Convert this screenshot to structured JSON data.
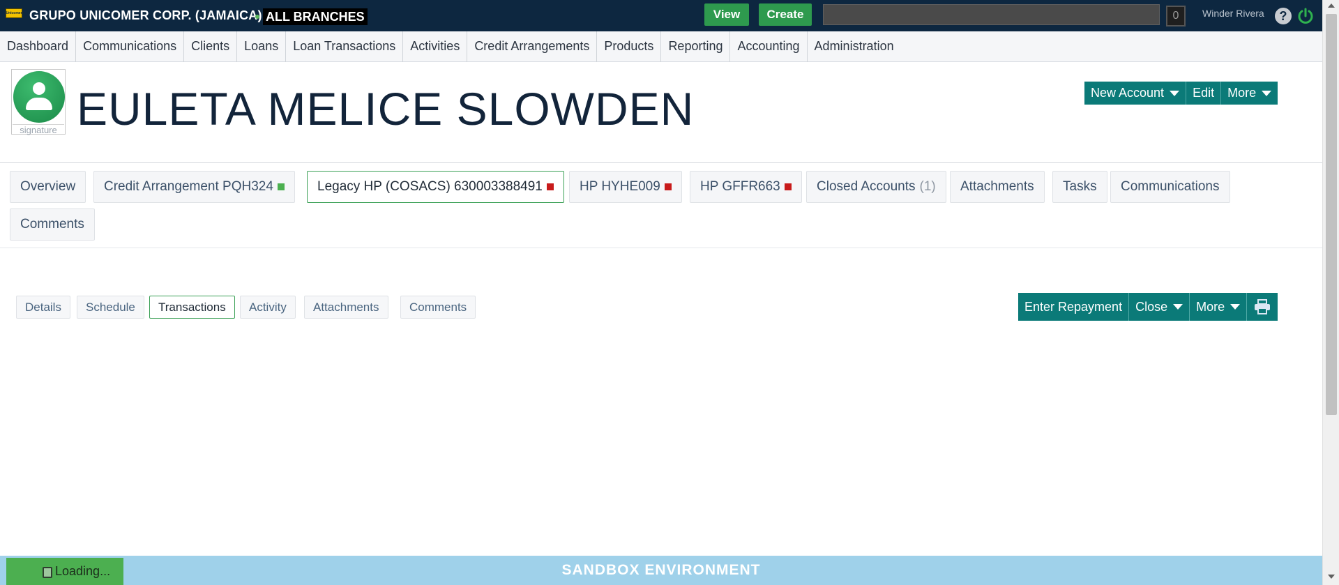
{
  "topbar": {
    "logo_text": "Unicomer",
    "org_name": "GRUPO UNICOMER CORP. (JAMAICA)",
    "branch": "ALL BRANCHES",
    "view_label": "View",
    "create_label": "Create",
    "search_value": "",
    "counter": "0",
    "user_name": "Winder Rivera",
    "help_glyph": "?"
  },
  "nav": {
    "items": [
      "Dashboard",
      "Communications",
      "Clients",
      "Loans",
      "Loan Transactions",
      "Activities",
      "Credit Arrangements",
      "Products",
      "Reporting",
      "Accounting",
      "Administration"
    ]
  },
  "client": {
    "name": "EULETA MELICE SLOWDEN",
    "avatar_caption": "signature",
    "actions": {
      "new_account": "New Account",
      "edit": "Edit",
      "more": "More"
    }
  },
  "account_tabs": {
    "overview": "Overview",
    "credit_arrangement": "Credit Arrangement PQH324",
    "legacy_hp": "Legacy HP (COSACS) 630003388491",
    "hp1": "HP HYHE009",
    "hp2": "HP GFFR663",
    "closed": "Closed Accounts",
    "closed_count": "(1)",
    "attachments": "Attachments",
    "tasks": "Tasks",
    "communications": "Communications",
    "comments": "Comments",
    "status_colors": {
      "active": "#4cb050",
      "alert": "#c81b1b"
    }
  },
  "sub_tabs": {
    "details": "Details",
    "schedule": "Schedule",
    "transactions": "Transactions",
    "activity": "Activity",
    "attachments": "Attachments",
    "comments": "Comments",
    "selected": "Transactions"
  },
  "account_actions": {
    "enter_repayment": "Enter Repayment",
    "close": "Close",
    "more": "More",
    "print_icon": "printer-icon"
  },
  "footer": {
    "environment": "SANDBOX ENVIRONMENT",
    "loading": "Loading..."
  },
  "colors": {
    "header_bg": "#0d2740",
    "accent_teal": "#0b7a78",
    "button_green": "#2e9a4e",
    "footer_bg": "#9fd1ea"
  }
}
